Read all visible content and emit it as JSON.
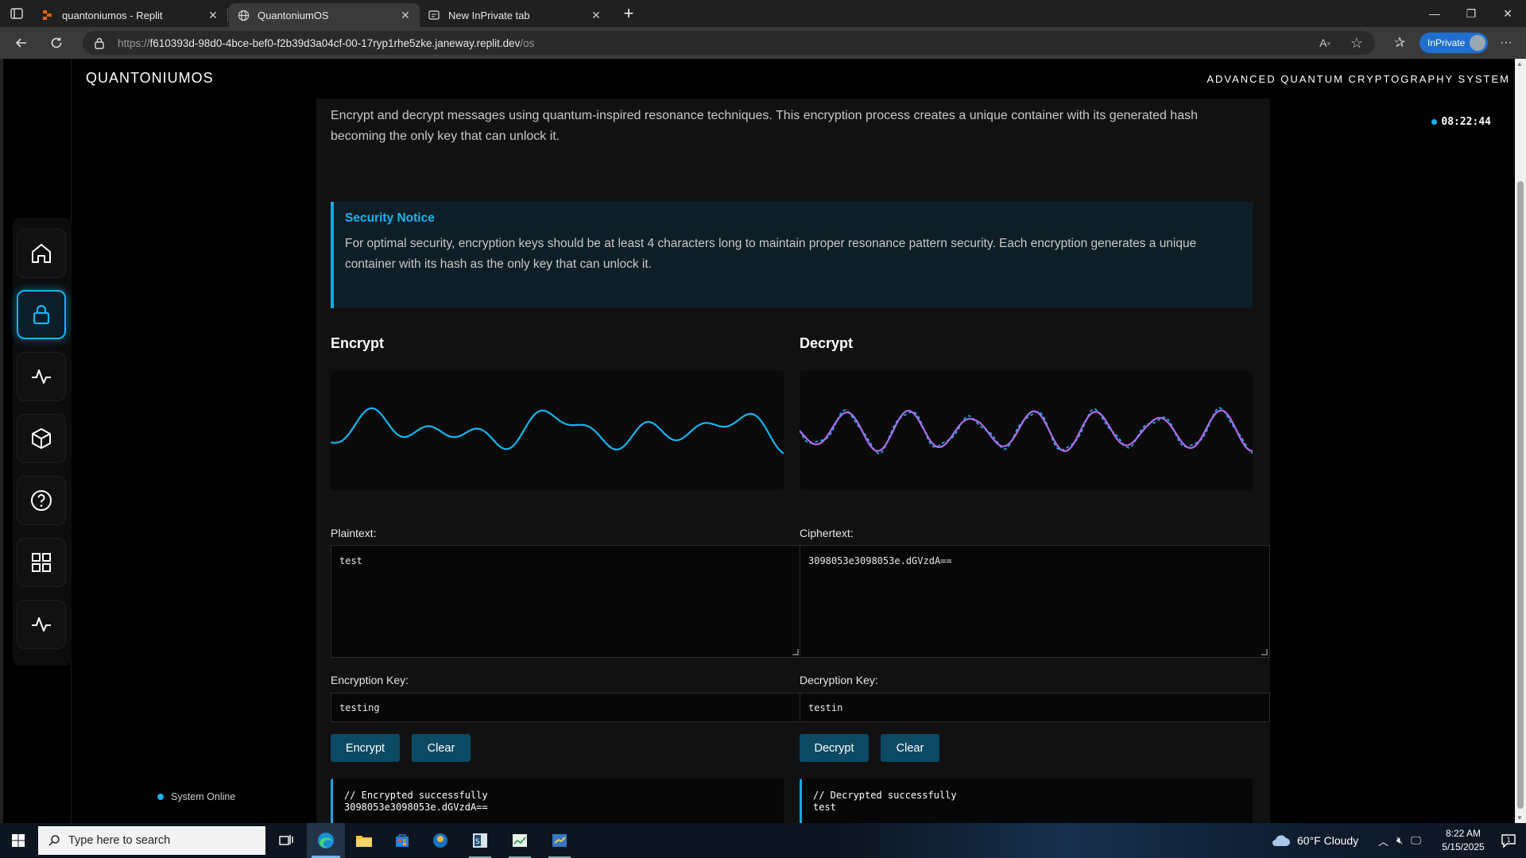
{
  "browser": {
    "tabs": [
      {
        "label": "quantoniumos - Replit",
        "icon": "replit-icon"
      },
      {
        "label": "QuantoniumOS",
        "icon": "globe-icon"
      },
      {
        "label": "New InPrivate tab",
        "icon": "inprivate-tab-icon"
      }
    ],
    "url_prefix": "https://",
    "url_host": "f610393d-98d0-4bce-bef0-f2b39d3a04cf-00-17ryp1rhe5zke.janeway.replit.dev",
    "url_path": "/os",
    "inprivate_label": "InPrivate"
  },
  "header": {
    "brand": "QUANTONIUMOS",
    "system_title": "ADVANCED QUANTUM CRYPTOGRAPHY SYSTEM",
    "clock": "08:22:44"
  },
  "sidebar": {
    "items": [
      {
        "name": "home",
        "icon": "home-icon",
        "active": false
      },
      {
        "name": "encryption",
        "icon": "lock-icon",
        "active": true
      },
      {
        "name": "resonance",
        "icon": "pulse-icon",
        "active": false
      },
      {
        "name": "container",
        "icon": "cube-icon",
        "active": false
      },
      {
        "name": "help",
        "icon": "help-icon",
        "active": false
      },
      {
        "name": "apps",
        "icon": "grid-icon",
        "active": false
      },
      {
        "name": "analytics",
        "icon": "activity-icon",
        "active": false
      }
    ]
  },
  "main": {
    "intro": "Encrypt and decrypt messages using quantum-inspired resonance techniques. This encryption process creates a unique container with its generated hash becoming the only key that can unlock it.",
    "notice": {
      "title": "Security Notice",
      "text": "For optimal security, encryption keys should be at least 4 characters long to maintain proper resonance pattern security. Each encryption generates a unique container with its hash as the only key that can unlock it."
    },
    "encrypt": {
      "title": "Encrypt",
      "input_label": "Plaintext:",
      "input_value": "test",
      "key_label": "Encryption Key:",
      "key_value": "testing",
      "action_label": "Encrypt",
      "clear_label": "Clear",
      "output_line1": "// Encrypted successfully",
      "output_line2": "3098053e3098053e.dGVzdA=="
    },
    "decrypt": {
      "title": "Decrypt",
      "input_label": "Ciphertext:",
      "input_value": "3098053e3098053e.dGVzdA==",
      "key_label": "Decryption Key:",
      "key_value": "testin",
      "action_label": "Decrypt",
      "clear_label": "Clear",
      "output_line1": "// Decrypted successfully",
      "output_line2": "test"
    },
    "status": "System Online"
  },
  "colors": {
    "accent": "#14b4f0",
    "button": "#0c4a63",
    "wave_purple": "#b06cf0"
  },
  "taskbar": {
    "search_placeholder": "Type here to search",
    "weather": "60°F  Cloudy",
    "time": "8:22 AM",
    "date": "5/15/2025",
    "notification_count": "1"
  }
}
